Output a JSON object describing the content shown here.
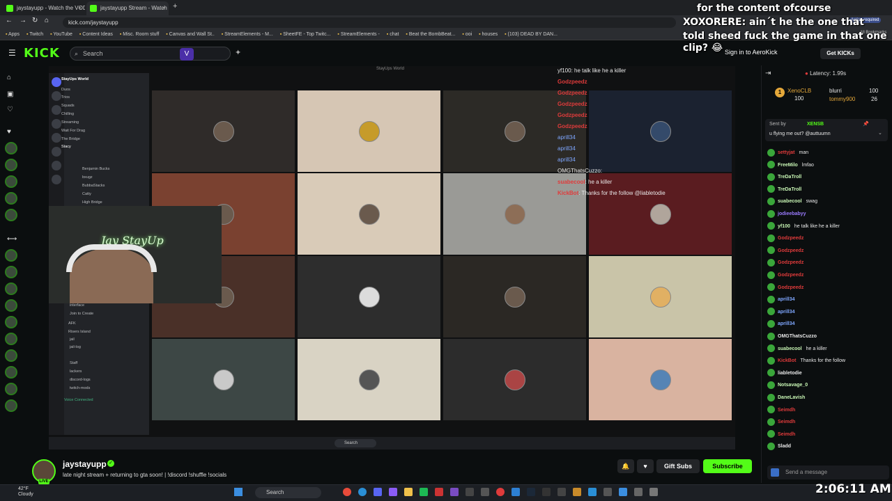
{
  "browser": {
    "tabs": [
      {
        "label": "jaystayupp - Watch the VOD o"
      },
      {
        "label": "jaystayupp Stream - Watch"
      }
    ],
    "url": "kick.com/jaystayupp",
    "action_required": "Action required",
    "bookmarks": [
      "Apps",
      "Twitch",
      "YouTube",
      "Content Ideas",
      "Misc. Room stuff",
      "Canvas and Wall St..",
      "StreamElements - M...",
      "SheetFE - Top Twitc...",
      "StreamElements -",
      "chat",
      "Beat the BombBeat...",
      "ooi",
      "houses",
      "(103) DEAD BY DAN..."
    ],
    "all_bookmarks": "All Bookmarks"
  },
  "header": {
    "logo": "KICK",
    "search_placeholder": "Search",
    "sign_in": "Sign in to AeroKick",
    "get_kicks": "Get KICKs"
  },
  "overlay_text": {
    "line1": "for the content ofcourse",
    "line2": "XOXORERE: ain´t he the one that",
    "line3": "told sheed fuck the game in that one",
    "line4": "clip? 😂"
  },
  "video": {
    "discord_server": "StayUps World",
    "discord_channels": [
      "Duos",
      "Trios",
      "Squads",
      "Chilling",
      "Streaming",
      "Wait For Drag",
      "The Bridge",
      "Stacy",
      "Benjamin Bucks",
      "bxugz",
      "BubbaStacks",
      "Catty",
      "High Bridge"
    ],
    "discord_lower": [
      "interface",
      "Join to Create",
      "AFK",
      "Risers Island",
      "jail",
      "jail-log",
      "Staff",
      "lackers",
      "discord-logs",
      "twitch-mods"
    ],
    "voice_connected": "Voice Connected",
    "window_title": "StayUps World",
    "neon_sign": "Jay StayUp",
    "inner_search": "Search",
    "overlay_chat": [
      {
        "user": "yf100",
        "msg": "he talk like he a killer"
      },
      {
        "user": "Godzpeedz",
        "msg": ""
      },
      {
        "user": "Godzpeedz",
        "msg": ""
      },
      {
        "user": "Godzpeedz",
        "msg": ""
      },
      {
        "user": "Godzpeedz",
        "msg": ""
      },
      {
        "user": "Godzpeedz",
        "msg": ""
      },
      {
        "user": "aprill34",
        "msg": ""
      },
      {
        "user": "aprill34",
        "msg": ""
      },
      {
        "user": "aprill34",
        "msg": ""
      },
      {
        "user": "OMGThatsCuzzo",
        "msg": ""
      },
      {
        "user": "suabecool",
        "msg": "he a killer"
      },
      {
        "user": "KickBot",
        "msg": "Thanks for the follow @liabletodie"
      }
    ]
  },
  "chat": {
    "latency": "Latency: 1.99s",
    "leaderboard": [
      {
        "name": "XenoCLB",
        "value": "100"
      },
      {
        "name": "blurri",
        "value": "100"
      },
      {
        "name": "tommy900",
        "value": "26"
      }
    ],
    "pinned_by": "Sent by",
    "pinned_user": "XENSB",
    "pinned_msg": "u flying me out? @auttuumn",
    "messages": [
      {
        "user": "settyjat",
        "msg": "man",
        "color": "#e03b3b"
      },
      {
        "user": "FreeMilo",
        "msg": "lmfao",
        "color": "#c9f7b5"
      },
      {
        "user": "TreDaTroll",
        "msg": "",
        "color": "#c9f7b5"
      },
      {
        "user": "TreDaTroll",
        "msg": "",
        "color": "#c9f7b5"
      },
      {
        "user": "suabecool",
        "msg": "swag",
        "color": "#c9f7b5"
      },
      {
        "user": "jodieebabyy",
        "msg": "",
        "color": "#9b7bff"
      },
      {
        "user": "yf100",
        "msg": "he talk like he a killer",
        "color": "#c9f7b5"
      },
      {
        "user": "Godzpeedz",
        "msg": "",
        "color": "#e03b3b"
      },
      {
        "user": "Godzpeedz",
        "msg": "",
        "color": "#e03b3b"
      },
      {
        "user": "Godzpeedz",
        "msg": "",
        "color": "#e03b3b"
      },
      {
        "user": "Godzpeedz",
        "msg": "",
        "color": "#e03b3b"
      },
      {
        "user": "Godzpeedz",
        "msg": "",
        "color": "#e03b3b"
      },
      {
        "user": "aprill34",
        "msg": "",
        "color": "#7fa7ff"
      },
      {
        "user": "aprill34",
        "msg": "",
        "color": "#7fa7ff"
      },
      {
        "user": "aprill34",
        "msg": "",
        "color": "#7fa7ff"
      },
      {
        "user": "OMGThatsCuzzo",
        "msg": "",
        "color": "#e8e8e8"
      },
      {
        "user": "suabecool",
        "msg": "he a killer",
        "color": "#c9f7b5"
      },
      {
        "user": "KickBot",
        "msg": "Thanks for the follow",
        "color": "#e03b3b"
      },
      {
        "user": "liabletodie",
        "msg": "",
        "color": "#e8e8e8"
      },
      {
        "user": "Notsavage_0",
        "msg": "",
        "color": "#c9f7b5"
      },
      {
        "user": "DaneLavish",
        "msg": "",
        "color": "#c9f7b5"
      },
      {
        "user": "Seimdh",
        "msg": "",
        "color": "#e03b3b"
      },
      {
        "user": "Seimdh",
        "msg": "",
        "color": "#e03b3b"
      },
      {
        "user": "Seimdh",
        "msg": "",
        "color": "#e03b3b"
      },
      {
        "user": "Sladd",
        "msg": "",
        "color": "#e8e8e8"
      }
    ],
    "send_placeholder": "Send a message"
  },
  "stream": {
    "streamer": "jaystayupp",
    "live": "LIVE",
    "title": "late night stream + returning to gta soon! | !discord !shuffle !socials",
    "gift_subs": "Gift Subs",
    "subscribe": "Subscribe"
  },
  "taskbar": {
    "temp": "42°F",
    "weather": "Cloudy",
    "search": "Search",
    "clock": "2:06:11 AM"
  },
  "colors": {
    "kick_green": "#53fc18",
    "bg": "#0b0e0f"
  }
}
